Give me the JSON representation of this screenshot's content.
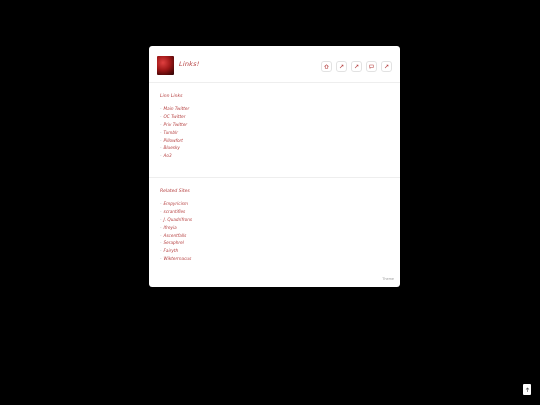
{
  "header": {
    "title": "Links!",
    "icons": [
      "home-icon",
      "link-icon",
      "link-icon",
      "chat-icon",
      "link-icon"
    ]
  },
  "sections": [
    {
      "title": "Linn Links",
      "items": [
        "Main Twitter",
        "OC Twitter",
        "Priv Twitter",
        "Tumblr",
        "Pillowfort",
        "Bluesky",
        "Ao3"
      ]
    },
    {
      "title": "Related Sites",
      "items": [
        "Empyricism",
        "scrantifles",
        "J. Quadrifrons",
        "Ifreyia",
        "Ascentfalls",
        "Seraphrel",
        "Fairyth",
        "Wikterrnacus"
      ]
    }
  ],
  "footer": {
    "credit": "Theme"
  },
  "colors": {
    "accent": "#b43c3c",
    "background": "#000000",
    "card": "#ffffff"
  },
  "corner_button": {
    "icon": "arrow-up-icon"
  }
}
